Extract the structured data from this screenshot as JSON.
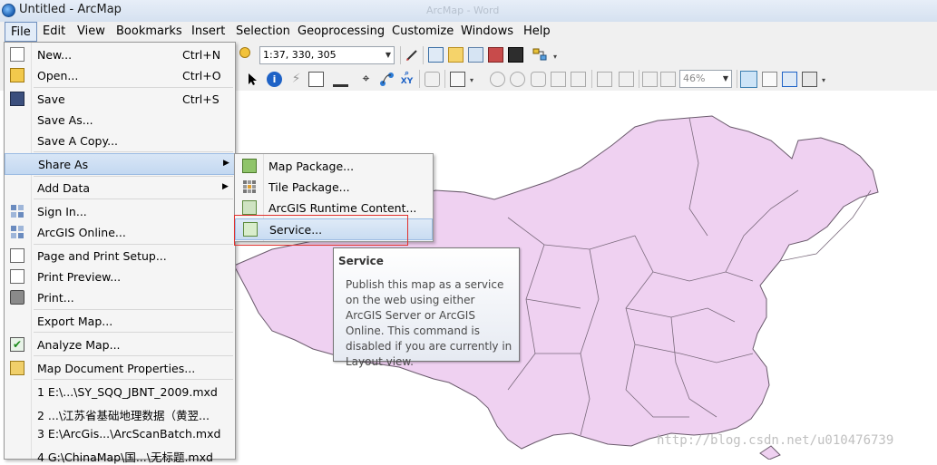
{
  "window": {
    "title": "Untitled - ArcMap",
    "ghost_title": "ArcMap - Word"
  },
  "menubar": [
    "File",
    "Edit",
    "View",
    "Bookmarks",
    "Insert",
    "Selection",
    "Geoprocessing",
    "Customize",
    "Windows",
    "Help"
  ],
  "toolbar": {
    "scale": "1:37, 330, 305",
    "zoom": "46%"
  },
  "file_menu": {
    "items": [
      {
        "label": "New...",
        "shortcut": "Ctrl+N",
        "icon": "new-document-icon"
      },
      {
        "label": "Open...",
        "shortcut": "Ctrl+O",
        "icon": "open-folder-icon"
      },
      {
        "label": "Save",
        "shortcut": "Ctrl+S",
        "icon": "save-disk-icon"
      },
      {
        "label": "Save As...",
        "shortcut": "",
        "icon": ""
      },
      {
        "label": "Save A Copy...",
        "shortcut": "",
        "icon": ""
      },
      {
        "label": "Share As",
        "shortcut": "",
        "icon": "",
        "submenu": true,
        "highlighted": true
      },
      {
        "label": "Add Data",
        "shortcut": "",
        "icon": "",
        "submenu": true
      },
      {
        "label": "Sign In...",
        "shortcut": "",
        "icon": "sign-in-icon"
      },
      {
        "label": "ArcGIS Online...",
        "shortcut": "",
        "icon": "arcgis-online-icon"
      },
      {
        "label": "Page and Print Setup...",
        "shortcut": "",
        "icon": "page-setup-icon"
      },
      {
        "label": "Print Preview...",
        "shortcut": "",
        "icon": "print-preview-icon"
      },
      {
        "label": "Print...",
        "shortcut": "",
        "icon": "printer-icon"
      },
      {
        "label": "Export Map...",
        "shortcut": "",
        "icon": ""
      },
      {
        "label": "Analyze Map...",
        "shortcut": "",
        "icon": "analyze-map-icon"
      },
      {
        "label": "Map Document Properties...",
        "shortcut": "",
        "icon": "document-properties-icon"
      },
      {
        "label": "1 E:\\...\\SY_SQQ_JBNT_2009.mxd",
        "shortcut": "",
        "icon": ""
      },
      {
        "label": "2 ...\\江苏省基础地理数据（黄翌...",
        "shortcut": "",
        "icon": ""
      },
      {
        "label": "3 E:\\ArcGis...\\ArcScanBatch.mxd",
        "shortcut": "",
        "icon": ""
      },
      {
        "label": "4 G:\\ChinaMap\\国...\\无标题.mxd",
        "shortcut": "",
        "icon": ""
      }
    ]
  },
  "share_submenu": {
    "items": [
      {
        "label": "Map Package...",
        "icon": "map-package-icon"
      },
      {
        "label": "Tile Package...",
        "icon": "tile-package-icon"
      },
      {
        "label": "ArcGIS Runtime Content...",
        "icon": "runtime-content-icon"
      },
      {
        "label": "Service...",
        "icon": "service-icon",
        "highlighted": true
      }
    ]
  },
  "tooltip": {
    "title": "Service",
    "body": "Publish this map as a service on the web using either ArcGIS Server or ArcGIS Online. This command is disabled if you are currently in Layout view."
  },
  "map": {
    "fill_color": "#efd1f1",
    "border_color": "#6a5a6c"
  },
  "watermark": "http://blog.csdn.net/u010476739",
  "colors": {
    "highlight_border": "#e0312e",
    "menu_highlight": "#c3d8f1"
  }
}
